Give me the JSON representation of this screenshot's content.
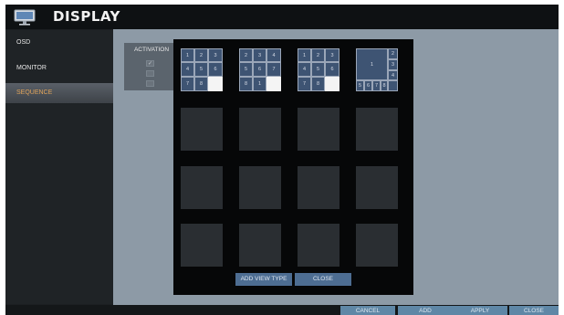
{
  "header": {
    "title": "DISPLAY",
    "icon": "monitor-icon"
  },
  "sidebar": {
    "items": [
      {
        "label": "OSD",
        "active": false
      },
      {
        "label": "MONITOR",
        "active": false
      },
      {
        "label": "SEQUENCE",
        "active": true
      }
    ]
  },
  "activation": {
    "label": "ACTIVATION",
    "checks": [
      "✓",
      "",
      ""
    ]
  },
  "dialog": {
    "layouts": [
      {
        "cells": [
          "1",
          "2",
          "3",
          "4",
          "5",
          "6",
          "7",
          "8",
          ""
        ]
      },
      {
        "cells": [
          "2",
          "3",
          "4",
          "5",
          "6",
          "7",
          "8",
          "1",
          ""
        ]
      },
      {
        "cells": [
          "1",
          "2",
          "3",
          "4",
          "5",
          "6",
          "7",
          "8",
          ""
        ]
      },
      {
        "cells": [
          "1",
          "2",
          "3",
          "4",
          "5",
          "6",
          "7",
          "8"
        ]
      }
    ],
    "buttons": {
      "add_view_type": "ADD VIEW TYPE",
      "close": "CLOSE"
    }
  },
  "footer": {
    "buttons": [
      "CANCEL",
      "ADD",
      "APPLY",
      "CLOSE"
    ]
  },
  "colors": {
    "accent": "#5f87a6",
    "active_text": "#e0a35a",
    "content_bg": "#8d9aa6"
  }
}
